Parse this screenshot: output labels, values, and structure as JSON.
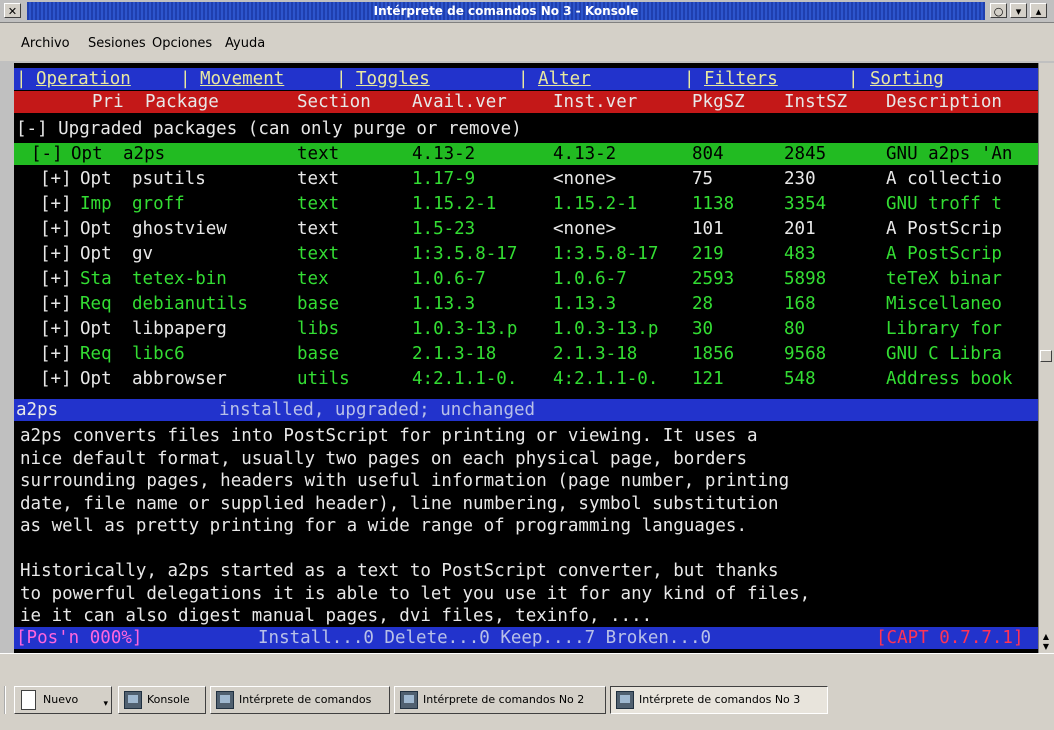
{
  "window": {
    "title": "Intérprete de comandos No 3 - Konsole",
    "close_glyph": "✕",
    "buttons": [
      "○",
      "▾",
      "▴"
    ]
  },
  "menubar": [
    "Archivo",
    "Sesiones",
    "Opciones",
    "Ayuda"
  ],
  "apt_menu": [
    {
      "sep": "|",
      "label": "Operation"
    },
    {
      "sep": "|",
      "label": "Movement"
    },
    {
      "sep": "|",
      "label": "Toggles"
    },
    {
      "sep": "|",
      "label": "Alter"
    },
    {
      "sep": "|",
      "label": "Filters"
    },
    {
      "sep": "|",
      "label": "Sorting"
    }
  ],
  "columns": [
    "Pri",
    "Package",
    "Section",
    "Avail.ver",
    "Inst.ver",
    "PkgSZ",
    "InstSZ",
    "Description"
  ],
  "group_header": "[-] Upgraded packages (can only purge or remove)",
  "packages": [
    {
      "toggle": "[-]",
      "pri": "Opt",
      "pkg": "a2ps",
      "section": "text",
      "avail": "4.13-2",
      "inst": "4.13-2",
      "pkgsz": "804",
      "instsz": "2845",
      "desc": "GNU a2ps 'An",
      "selected": true
    },
    {
      "toggle": "[+]",
      "pri": "Opt",
      "pkg": "psutils",
      "section": "text",
      "avail": "1.17-9",
      "inst": "<none>",
      "pkgsz": "75",
      "instsz": "230",
      "desc": "A collectio"
    },
    {
      "toggle": "[+]",
      "pri": "Imp",
      "pkg": "groff",
      "section": "text",
      "avail": "1.15.2-1",
      "inst": "1.15.2-1",
      "pkgsz": "1138",
      "instsz": "3354",
      "desc": "GNU troff t"
    },
    {
      "toggle": "[+]",
      "pri": "Opt",
      "pkg": "ghostview",
      "section": "text",
      "avail": "1.5-23",
      "inst": "<none>",
      "pkgsz": "101",
      "instsz": "201",
      "desc": "A PostScrip"
    },
    {
      "toggle": "[+]",
      "pri": "Opt",
      "pkg": "gv",
      "section": "text",
      "avail": "1:3.5.8-17",
      "inst": "1:3.5.8-17",
      "pkgsz": "219",
      "instsz": "483",
      "desc": "A PostScrip"
    },
    {
      "toggle": "[+]",
      "pri": "Sta",
      "pkg": "tetex-bin",
      "section": "tex",
      "avail": "1.0.6-7",
      "inst": "1.0.6-7",
      "pkgsz": "2593",
      "instsz": "5898",
      "desc": "teTeX binar"
    },
    {
      "toggle": "[+]",
      "pri": "Req",
      "pkg": "debianutils",
      "section": "base",
      "avail": "1.13.3",
      "inst": "1.13.3",
      "pkgsz": "28",
      "instsz": "168",
      "desc": "Miscellaneo"
    },
    {
      "toggle": "[+]",
      "pri": "Opt",
      "pkg": "libpaperg",
      "section": "libs",
      "avail": "1.0.3-13.p",
      "inst": "1.0.3-13.p",
      "pkgsz": "30",
      "instsz": "80",
      "desc": "Library for"
    },
    {
      "toggle": "[+]",
      "pri": "Req",
      "pkg": "libc6",
      "section": "base",
      "avail": "2.1.3-18",
      "inst": "2.1.3-18",
      "pkgsz": "1856",
      "instsz": "9568",
      "desc": "GNU C Libra"
    },
    {
      "toggle": "[+]",
      "pri": "Opt",
      "pkg": "abbrowser",
      "section": "utils",
      "avail": "4:2.1.1-0.",
      "inst": "4:2.1.1-0.",
      "pkgsz": "121",
      "instsz": "548",
      "desc": "Address book"
    }
  ],
  "status_bar": {
    "pkg": "a2ps",
    "state": "installed, upgraded; unchanged"
  },
  "description_lines": [
    "a2ps converts files into PostScript for printing or viewing. It uses a",
    "nice default format, usually two pages on each physical page, borders",
    "surrounding pages, headers with useful information (page number, printing",
    "date, file name or supplied header), line numbering, symbol substitution",
    "as well as pretty printing for a wide range of programming languages.",
    "",
    "Historically, a2ps started as a text to PostScript converter, but thanks",
    "to powerful delegations it is able to let you use it for any kind of files,",
    "ie it can also digest manual pages, dvi files, texinfo, ...."
  ],
  "footer": {
    "pos": "[Pos'n 000%]",
    "counts": "Install...0 Delete...0 Keep....7 Broken...0",
    "version": "[CAPT 0.7.7.1]"
  },
  "taskbar": [
    {
      "label": "Nuevo",
      "icon": "new-doc-icon"
    },
    {
      "label": "Konsole",
      "icon": "konsole-icon"
    },
    {
      "label": "Intérprete de comandos",
      "icon": "konsole-icon"
    },
    {
      "label": "Intérprete de comandos No 2",
      "icon": "konsole-icon"
    },
    {
      "label": "Intérprete de comandos No 3",
      "icon": "konsole-icon",
      "active": true
    }
  ]
}
